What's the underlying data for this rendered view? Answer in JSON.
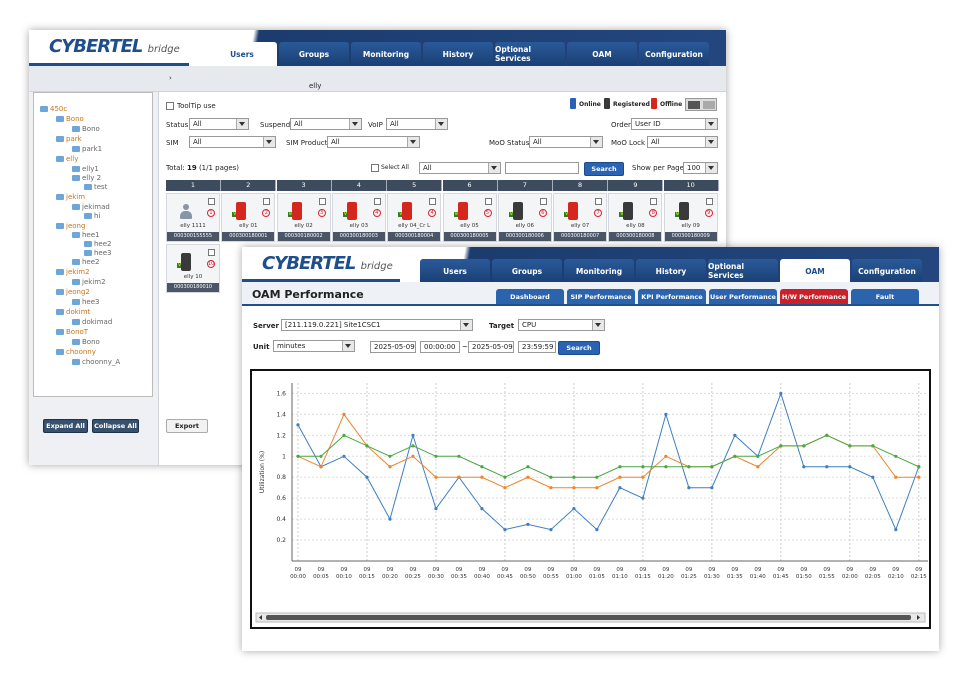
{
  "w1": {
    "logo": "CYBERTEL",
    "logo_sub": "bridge",
    "tabs": [
      "Users",
      "Groups",
      "Monitoring",
      "History",
      "Optional Services",
      "OAM",
      "Configuration"
    ],
    "breadcrumb": "elly",
    "tooltip": "ToolTip use",
    "legend": {
      "online": "Online",
      "registered": "Registered",
      "offline": "Offline"
    },
    "filters": {
      "status_label": "Status",
      "status_val": "All",
      "suspend_label": "Suspend",
      "suspend_val": "All",
      "voip_label": "VoIP",
      "voip_val": "All",
      "order_label": "Order",
      "order_val": "User ID",
      "sim_label": "SIM",
      "sim_val": "All",
      "simprod_label": "SIM Product",
      "simprod_val": "All",
      "moo_label": "MoO Status",
      "moo_val": "All",
      "moolock_label": "MoO Lock",
      "moolock_val": "All"
    },
    "total_label": "Total:",
    "total_num": "19",
    "total_pages": "(1/1 pages)",
    "select_all": "Select All",
    "select_all_val": "All",
    "search": "Search",
    "show_per_page": "Show per Page",
    "per_page_val": "100",
    "columns": [
      "1",
      "2",
      "3",
      "4",
      "5",
      "6",
      "7",
      "8",
      "9",
      "10"
    ],
    "row1": [
      {
        "name": "elly 1111",
        "id": "000300155555",
        "num": "1",
        "dev": "person"
      },
      {
        "name": "elly 01",
        "id": "000300180001",
        "num": "2",
        "dev": "off"
      },
      {
        "name": "elly 02",
        "id": "000300180002",
        "num": "3",
        "dev": "off"
      },
      {
        "name": "elly 03",
        "id": "000300180003",
        "num": "4",
        "dev": "off"
      },
      {
        "name": "elly 04_Cr L",
        "id": "000300180004",
        "num": "4",
        "dev": "off"
      },
      {
        "name": "elly 05",
        "id": "000300180005",
        "num": "5",
        "dev": "off"
      },
      {
        "name": "elly 06",
        "id": "000300180006",
        "num": "6",
        "dev": "reg"
      },
      {
        "name": "elly 07",
        "id": "000300180007",
        "num": "7",
        "dev": "off"
      },
      {
        "name": "elly 08",
        "id": "000300180008",
        "num": "8",
        "dev": "reg"
      },
      {
        "name": "elly 09",
        "id": "000300180009",
        "num": "9",
        "dev": "reg"
      }
    ],
    "row2": [
      {
        "name": "elly 10",
        "id": "000300180010",
        "num": "10",
        "dev": "reg"
      }
    ],
    "tree": [
      {
        "t": "450c",
        "x": 6,
        "y": 12,
        "c": "org"
      },
      {
        "t": "Bono",
        "x": 22,
        "y": 22,
        "c": "org"
      },
      {
        "t": "Bono",
        "x": 38,
        "y": 32,
        "c": "lf"
      },
      {
        "t": "park",
        "x": 22,
        "y": 42,
        "c": "org"
      },
      {
        "t": "park1",
        "x": 38,
        "y": 52,
        "c": "lf"
      },
      {
        "t": "elly",
        "x": 22,
        "y": 62,
        "c": "org"
      },
      {
        "t": "elly1",
        "x": 38,
        "y": 72,
        "c": "lf"
      },
      {
        "t": "elly 2",
        "x": 38,
        "y": 81,
        "c": "lf"
      },
      {
        "t": "test",
        "x": 50,
        "y": 90,
        "c": "lf"
      },
      {
        "t": "jekim",
        "x": 22,
        "y": 100,
        "c": "org"
      },
      {
        "t": "jekimad",
        "x": 38,
        "y": 110,
        "c": "lf"
      },
      {
        "t": "hi",
        "x": 50,
        "y": 119,
        "c": "lf"
      },
      {
        "t": "jeong",
        "x": 22,
        "y": 129,
        "c": "org"
      },
      {
        "t": "hee1",
        "x": 38,
        "y": 138,
        "c": "lf"
      },
      {
        "t": "hee2",
        "x": 50,
        "y": 147,
        "c": "lf"
      },
      {
        "t": "hee3",
        "x": 50,
        "y": 156,
        "c": "lf"
      },
      {
        "t": "hee2",
        "x": 38,
        "y": 165,
        "c": "lf"
      },
      {
        "t": "jekim2",
        "x": 22,
        "y": 175,
        "c": "org"
      },
      {
        "t": "jekim2",
        "x": 38,
        "y": 185,
        "c": "lf"
      },
      {
        "t": "jeong2",
        "x": 22,
        "y": 195,
        "c": "org"
      },
      {
        "t": "hee3",
        "x": 38,
        "y": 205,
        "c": "lf"
      },
      {
        "t": "dokimt",
        "x": 22,
        "y": 215,
        "c": "org"
      },
      {
        "t": "dokimad",
        "x": 38,
        "y": 225,
        "c": "lf"
      },
      {
        "t": "BonoT",
        "x": 22,
        "y": 235,
        "c": "org"
      },
      {
        "t": "Bono",
        "x": 38,
        "y": 245,
        "c": "lf"
      },
      {
        "t": "choonny",
        "x": 22,
        "y": 255,
        "c": "org"
      },
      {
        "t": "choonny_A",
        "x": 38,
        "y": 265,
        "c": "lf"
      }
    ],
    "expand_all": "Expand All",
    "collapse_all": "Collapse All",
    "export": "Export"
  },
  "w2": {
    "logo": "CYBERTEL",
    "logo_sub": "bridge",
    "tabs": [
      "Users",
      "Groups",
      "Monitoring",
      "History",
      "Optional Services",
      "OAM",
      "Configuration"
    ],
    "title": "OAM Performance",
    "subtabs": [
      "Dashboard",
      "SIP Performance",
      "KPI Performance",
      "User Performance",
      "H/W Performance",
      "Fault"
    ],
    "server_label": "Server",
    "server_val": "[211.119.0.221] Site1CSC1",
    "target_label": "Target",
    "target_val": "CPU",
    "unit_label": "Unit",
    "unit_val": "minutes",
    "date_from": "2025-05-09",
    "time_from": "00:00:00",
    "tilde": "~",
    "date_to": "2025-05-09",
    "time_to": "23:59:59",
    "search": "Search"
  },
  "chart_data": {
    "type": "line",
    "ylabel": "Utilization (%)",
    "ylim": [
      0,
      1.7
    ],
    "yticks": [
      "0.2",
      "0.4",
      "0.6",
      "0.8",
      "1",
      "1.2",
      "1.4",
      "1.6"
    ],
    "x": [
      "09 00:00",
      "09 00:05",
      "09 00:10",
      "09 00:15",
      "09 00:20",
      "09 00:25",
      "09 00:30",
      "09 00:35",
      "09 00:40",
      "09 00:45",
      "09 00:50",
      "09 00:55",
      "09 01:00",
      "09 01:05",
      "09 01:10",
      "09 01:15",
      "09 01:20",
      "09 01:25",
      "09 01:30",
      "09 01:35",
      "09 01:40",
      "09 01:45",
      "09 01:50",
      "09 01:55",
      "09 02:00",
      "09 02:05",
      "09 02:10",
      "09 02:15"
    ],
    "series": [
      {
        "color": "#3d7fc2",
        "values": [
          1.3,
          0.9,
          1.0,
          0.8,
          0.4,
          1.2,
          0.5,
          0.8,
          0.5,
          0.3,
          0.35,
          0.3,
          0.5,
          0.3,
          0.7,
          0.6,
          1.4,
          0.7,
          0.7,
          1.2,
          1.0,
          1.6,
          0.9,
          0.9,
          0.9,
          0.8,
          0.3,
          0.9
        ]
      },
      {
        "color": "#f0832a",
        "values": [
          1.0,
          0.9,
          1.4,
          1.1,
          0.9,
          1.0,
          0.8,
          0.8,
          0.8,
          0.7,
          0.8,
          0.7,
          0.7,
          0.7,
          0.8,
          0.8,
          1.0,
          0.9,
          0.9,
          1.0,
          0.9,
          1.1,
          1.1,
          1.2,
          1.1,
          1.1,
          0.8,
          0.8
        ]
      },
      {
        "color": "#4aa843",
        "values": [
          1.0,
          1.0,
          1.2,
          1.1,
          1.0,
          1.1,
          1.0,
          1.0,
          0.9,
          0.8,
          0.9,
          0.8,
          0.8,
          0.8,
          0.9,
          0.9,
          0.9,
          0.9,
          0.9,
          1.0,
          1.0,
          1.1,
          1.1,
          1.2,
          1.1,
          1.1,
          1.0,
          0.9
        ]
      }
    ]
  }
}
